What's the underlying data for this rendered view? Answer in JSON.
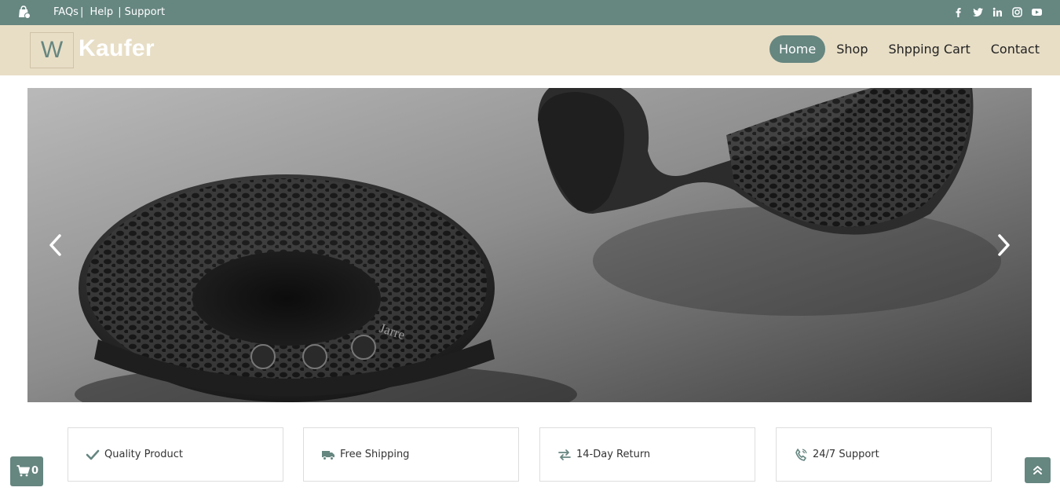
{
  "topbar": {
    "shop_icon": "shopping-bag-icon",
    "links": [
      "FAQs",
      "Help",
      "Support"
    ],
    "social_icons": [
      "facebook-icon",
      "twitter-icon",
      "linkedin-icon",
      "instagram-icon",
      "youtube-icon"
    ]
  },
  "header": {
    "logo_letter": "W",
    "brand_name": "Kaufer",
    "nav": [
      "Home",
      "Shop",
      "Shpping Cart",
      "Contact"
    ],
    "active_nav": "Home"
  },
  "carousel": {
    "prev_icon": "chevron-left-icon",
    "next_icon": "chevron-right-icon",
    "speaker_brand": "Jarre"
  },
  "features": [
    {
      "label": "Quality Product",
      "icon": "check-icon"
    },
    {
      "label": "Free Shipping",
      "icon": "truck-icon"
    },
    {
      "label": "14-Day Return",
      "icon": "exchange-icon"
    },
    {
      "label": "24/7 Support",
      "icon": "phone-icon"
    }
  ],
  "cart": {
    "count": "0",
    "icon": "cart-icon"
  },
  "back_to_top": {
    "icon": "double-chevron-up-icon"
  },
  "colors": {
    "accent": "#668680",
    "header_bg": "#e8dec6",
    "white": "#ffffff"
  }
}
